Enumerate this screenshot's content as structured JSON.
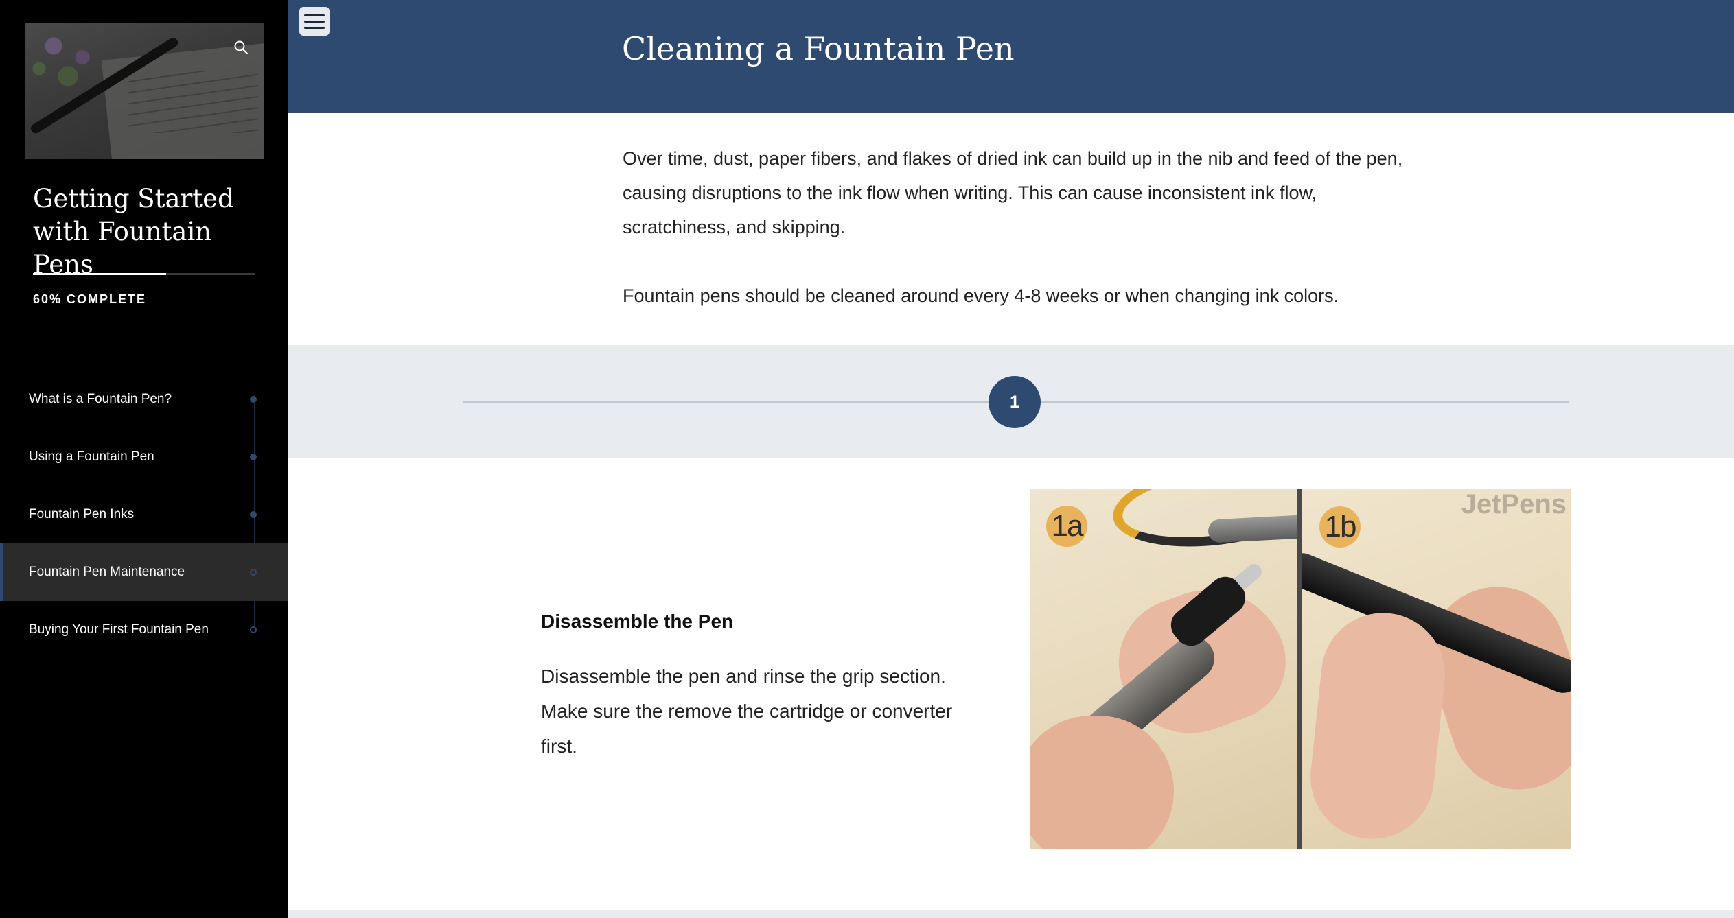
{
  "sidebar": {
    "course_title": "Getting Started with Fountain Pens",
    "progress_label": "60% COMPLETE",
    "progress_fraction": 0.6,
    "search_icon": "search-icon",
    "items": [
      {
        "label": "What is a Fountain Pen?",
        "active": false,
        "dot": "filled"
      },
      {
        "label": "Using a Fountain Pen",
        "active": false,
        "dot": "filled"
      },
      {
        "label": "Fountain Pen Inks",
        "active": false,
        "dot": "filled"
      },
      {
        "label": "Fountain Pen Maintenance",
        "active": true,
        "dot": "hollow"
      },
      {
        "label": "Buying Your First Fountain Pen",
        "active": false,
        "dot": "hollow"
      }
    ]
  },
  "header": {
    "menu_icon": "hamburger-menu-icon",
    "title": "Cleaning a Fountain Pen"
  },
  "intro": {
    "paragraphs": [
      "Over time, dust, paper fibers, and flakes of dried ink can build up in the nib and feed of the pen, causing disruptions to the ink flow when writing. This can cause inconsistent ink flow, scratchiness, and skipping.",
      "Fountain pens should be cleaned around every 4-8 weeks or when changing ink colors."
    ]
  },
  "step": {
    "number": "1",
    "title": "Disassemble the Pen",
    "body": "Disassemble the pen and rinse the grip section. Make sure the remove the cartridge or converter first.",
    "image": {
      "badge_a": "1a",
      "badge_b": "1b",
      "watermark": "JetPens"
    }
  },
  "colors": {
    "sidebar_bg": "#000000",
    "header_bg": "#2e4a70",
    "accent": "#2e4a70",
    "band_bg": "#e8ebef",
    "active_item_bg": "#2b2b2b"
  }
}
